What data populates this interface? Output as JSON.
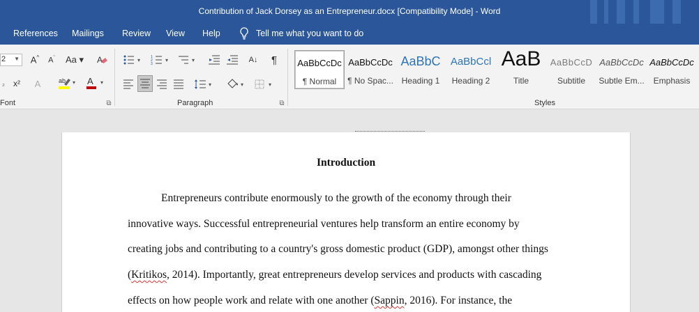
{
  "window": {
    "title": "Contribution of Jack Dorsey as an Entrepreneur.docx [Compatibility Mode]  -  Word"
  },
  "menu": {
    "items": [
      "References",
      "Mailings",
      "Review",
      "View",
      "Help"
    ],
    "tell_me": "Tell me what you want to do"
  },
  "ribbon": {
    "font_size_value": "2",
    "groups": {
      "font": "Font",
      "paragraph": "Paragraph",
      "styles": "Styles"
    },
    "font_color": "#c00000",
    "highlight_color": "#ffff00",
    "styles": [
      {
        "sample": "AaBbCcDc",
        "name": "¶ Normal"
      },
      {
        "sample": "AaBbCcDc",
        "name": "¶ No Spac..."
      },
      {
        "sample": "AaBbC",
        "name": "Heading 1"
      },
      {
        "sample": "AaBbCcl",
        "name": "Heading 2"
      },
      {
        "sample": "AaB",
        "name": "Title"
      },
      {
        "sample": "AaBbCcD",
        "name": "Subtitle"
      },
      {
        "sample": "AaBbCcDc",
        "name": "Subtle Em..."
      },
      {
        "sample": "AaBbCcDc",
        "name": "Emphasis"
      }
    ]
  },
  "document": {
    "heading": "Introduction",
    "lines": [
      "Entrepreneurs contribute enormously to the growth of the economy through their",
      "innovative ways. Successful entrepreneurial ventures help transform an entire economy by",
      "creating jobs and contributing to a country's gross domestic product (GDP), amongst other things",
      {
        "pre": "(",
        "err": "Kritikos",
        "post": ", 2014). Importantly, great entrepreneurs develop services and products with cascading"
      },
      {
        "pre": "effects on how people work and relate with one another (",
        "err": "Sappin",
        "post": ", 2016). For instance, the"
      }
    ]
  }
}
